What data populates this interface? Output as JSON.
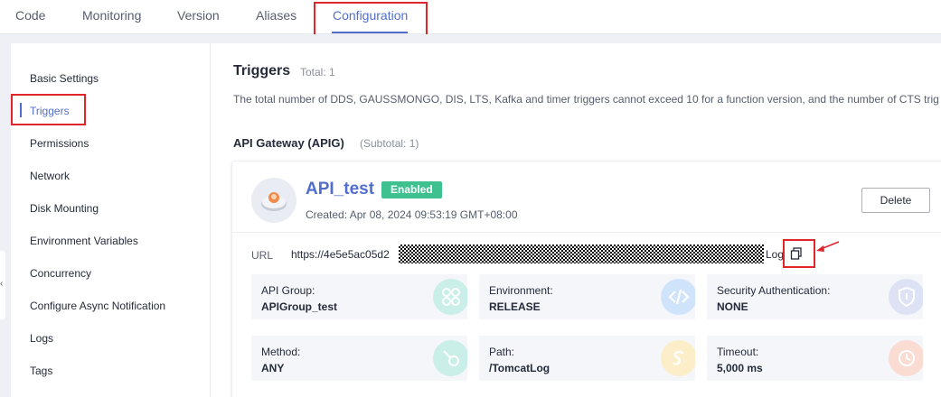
{
  "tabs": [
    {
      "label": "Code"
    },
    {
      "label": "Monitoring"
    },
    {
      "label": "Version"
    },
    {
      "label": "Aliases"
    },
    {
      "label": "Configuration"
    }
  ],
  "active_tab": "Configuration",
  "sidebar": {
    "items": [
      {
        "label": "Basic Settings"
      },
      {
        "label": "Triggers"
      },
      {
        "label": "Permissions"
      },
      {
        "label": "Network"
      },
      {
        "label": "Disk Mounting"
      },
      {
        "label": "Environment Variables"
      },
      {
        "label": "Concurrency"
      },
      {
        "label": "Configure Async Notification"
      },
      {
        "label": "Logs"
      },
      {
        "label": "Tags"
      }
    ],
    "active": "Triggers"
  },
  "main": {
    "title": "Triggers",
    "total": "Total: 1",
    "notice": "The total number of DDS, GAUSSMONGO, DIS, LTS, Kafka and timer triggers cannot exceed 10 for a function version, and the number of CTS trig",
    "section_title": "API Gateway (APIG)",
    "section_subtotal": "(Subtotal: 1)"
  },
  "trigger": {
    "name": "API_test",
    "status": "Enabled",
    "created": "Created: Apr 08, 2024 09:53:19 GMT+08:00",
    "delete_label": "Delete",
    "url_label": "URL",
    "url_prefix": "https://4e5e5ac05d2",
    "url_suffix": "Log",
    "details": [
      {
        "label": "API Group:",
        "value": "APIGroup_test",
        "icon": "group-icon",
        "color": "#c9efe8"
      },
      {
        "label": "Environment:",
        "value": "RELEASE",
        "icon": "code-icon",
        "color": "#cfe4fb"
      },
      {
        "label": "Security Authentication:",
        "value": "NONE",
        "icon": "shield-icon",
        "color": "#dde3f5"
      },
      {
        "label": "Method:",
        "value": "ANY",
        "icon": "method-icon",
        "color": "#c9efe8"
      },
      {
        "label": "Path:",
        "value": "/TomcatLog",
        "icon": "path-icon",
        "color": "#fbeec8"
      },
      {
        "label": "Timeout:",
        "value": "5,000 ms",
        "icon": "clock-icon",
        "color": "#fbdcd3"
      }
    ]
  },
  "colors": {
    "accent": "#526ecc",
    "enabled": "#3ec18f",
    "annotation": "#e0262b"
  }
}
